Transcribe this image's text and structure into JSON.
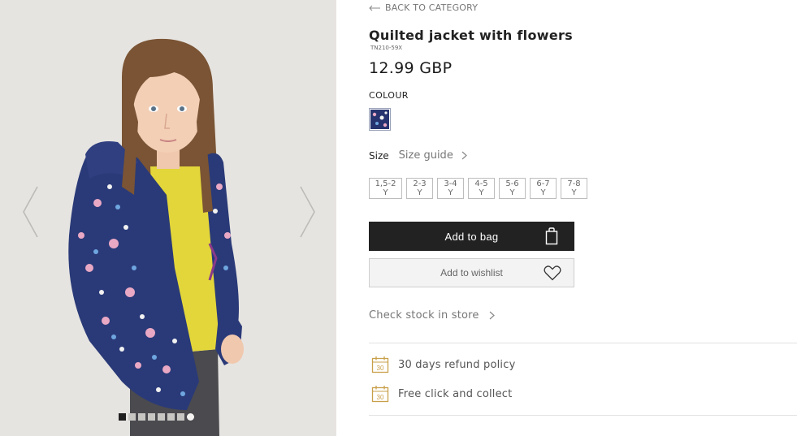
{
  "gallery": {
    "slide_count": 8,
    "active_index": 0
  },
  "product": {
    "back_label": "BACK TO CATEGORY",
    "title": "Quilted jacket with flowers",
    "sku": "TN210-59X",
    "price": "12.99 GBP",
    "colour_label": "COLOUR",
    "size_label": "Size",
    "size_guide_label": "Size guide",
    "sizes": [
      "1,5-2 Y",
      "2-3 Y",
      "3-4 Y",
      "4-5 Y",
      "5-6 Y",
      "6-7 Y",
      "7-8 Y"
    ],
    "add_to_bag_label": "Add to bag",
    "add_to_wishlist_label": "Add to wishlist",
    "check_stock_label": "Check stock in store"
  },
  "features": [
    {
      "icon": "calendar-30-icon",
      "badge": "30",
      "label": "30 days refund policy"
    },
    {
      "icon": "calendar-30-icon",
      "badge": "30",
      "label": "Free click and collect"
    }
  ],
  "colors": {
    "accent_gold": "#c9a04a",
    "button_dark": "#222222",
    "jacket_navy": "#2a3a78"
  }
}
